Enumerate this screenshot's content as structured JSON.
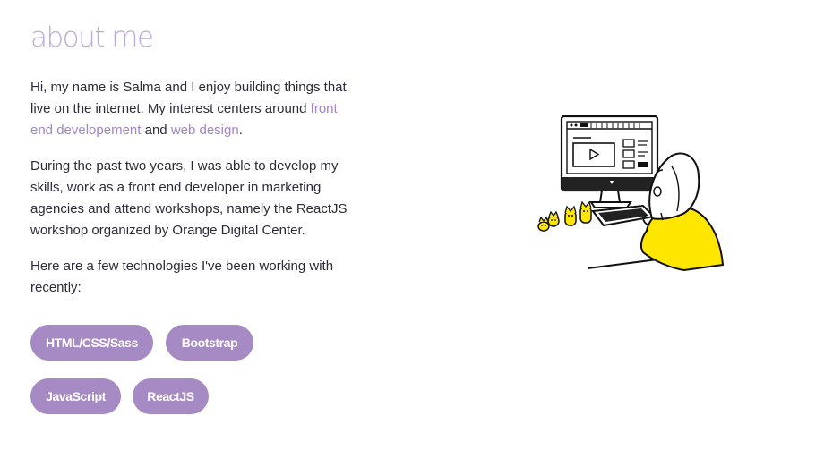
{
  "section": {
    "title": "about me"
  },
  "intro": {
    "text_before": "Hi, my name is Salma and I enjoy building things that live on the internet. My interest centers around ",
    "link1": "front end developement",
    "text_and": " and ",
    "link2": "web design",
    "text_end": "."
  },
  "experience": {
    "text": "During the past two years, I was able to develop my skills, work as a front end developer in marketing agencies and attend workshops, namely the ReactJS workshop organized by Orange Digital Center."
  },
  "technologies": {
    "intro": "Here are a few technologies I've been working with recently:",
    "items": [
      "HTML/CSS/Sass",
      "Bootstrap",
      "JavaScript",
      "ReactJS"
    ]
  },
  "colors": {
    "accent": "#a68ac4",
    "title": "#c1a9dc",
    "illustration_highlight": "#ffe600"
  }
}
